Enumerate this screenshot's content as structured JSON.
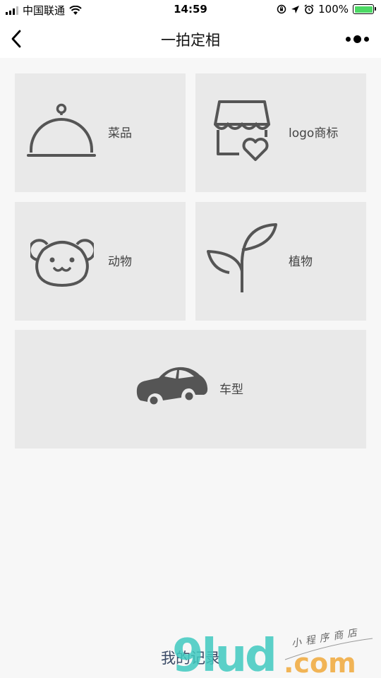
{
  "status_bar": {
    "carrier": "中国联通",
    "time": "14:59",
    "battery": "100%"
  },
  "nav": {
    "title": "一拍定相"
  },
  "categories": [
    {
      "label": "菜品",
      "icon": "food-cover-icon"
    },
    {
      "label": "logo商标",
      "icon": "shop-heart-icon"
    },
    {
      "label": "动物",
      "icon": "bear-face-icon"
    },
    {
      "label": "植物",
      "icon": "sprout-icon"
    },
    {
      "label": "车型",
      "icon": "car-icon"
    }
  ],
  "bottom_link": "我的记录",
  "watermark": {
    "brand": "9lud",
    "domain": ".com",
    "tagline": "小程序商店"
  },
  "colors": {
    "card_bg": "#e9e9e9",
    "icon": "#555555",
    "battery": "#4cd964"
  }
}
